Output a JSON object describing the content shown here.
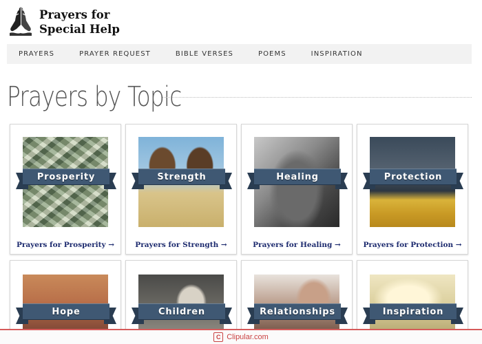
{
  "site": {
    "logo_line1": "Prayers for",
    "logo_line2": "Special Help",
    "logo_icon": "praying-hands-icon"
  },
  "nav": {
    "items": [
      {
        "label": "PRAYERS"
      },
      {
        "label": "PRAYER REQUEST"
      },
      {
        "label": "BIBLE VERSES"
      },
      {
        "label": "POEMS"
      },
      {
        "label": "INSPIRATION"
      }
    ]
  },
  "page": {
    "title": "Prayers by Topic"
  },
  "topics": [
    {
      "ribbon": "Prosperity",
      "link": "Prayers for Prosperity →",
      "image": "money-bills"
    },
    {
      "ribbon": "Strength",
      "link": "Prayers for Strength →",
      "image": "rams-fighting"
    },
    {
      "ribbon": "Healing",
      "link": "Prayers for Healing →",
      "image": "holding-hands"
    },
    {
      "ribbon": "Protection",
      "link": "Prayers for Protection →",
      "image": "storm-over-field"
    },
    {
      "ribbon": "Hope",
      "link": "",
      "image": "rainbow-sunset"
    },
    {
      "ribbon": "Children",
      "link": "",
      "image": "children"
    },
    {
      "ribbon": "Relationships",
      "link": "",
      "image": "couple-embrace"
    },
    {
      "ribbon": "Inspiration",
      "link": "",
      "image": "sunlight-field"
    }
  ],
  "footer": {
    "brand_icon": "clipular-logo-icon",
    "icon_letter": "C",
    "text": "Clipular.com"
  },
  "colors": {
    "ribbon": "#3f5873",
    "link": "#1c2a6e",
    "footer_accent": "#c94040"
  }
}
